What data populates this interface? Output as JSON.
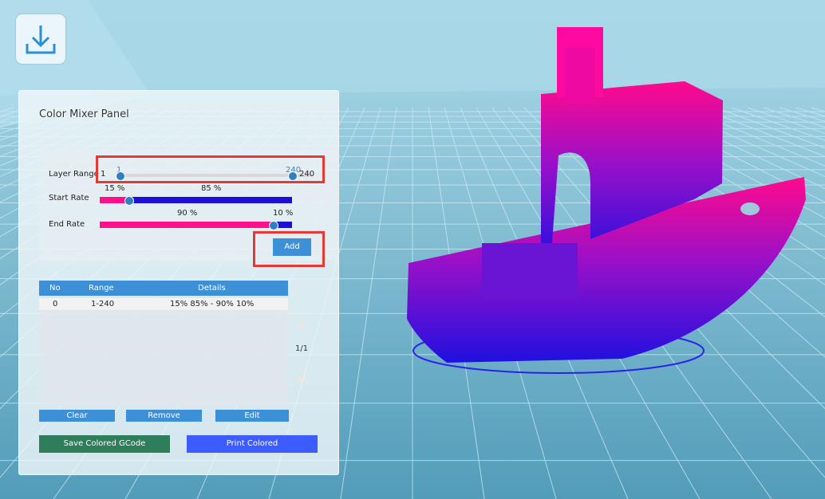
{
  "panel": {
    "title": "Color Mixer Panel",
    "layer_range": {
      "label": "Layer Range",
      "min_value": "1",
      "max_value": "240",
      "start_marker": "1",
      "end_marker": "240"
    },
    "start_rate": {
      "label": "Start Rate",
      "left_percent": "15 %",
      "right_percent": "85 %",
      "value_fraction": 0.15
    },
    "end_rate": {
      "label": "End Rate",
      "left_percent": "90 %",
      "right_percent": "10 %",
      "value_fraction": 0.9
    },
    "add_label": "Add"
  },
  "table": {
    "headers": {
      "no": "No",
      "range": "Range",
      "details": "Details"
    },
    "rows": [
      {
        "no": "0",
        "range": "1-240",
        "details": "15% 85% - 90% 10%"
      }
    ],
    "pager": "1/1"
  },
  "actions": {
    "clear_label": "Clear",
    "remove_label": "Remove",
    "edit_label": "Edit",
    "save_label": "Save Colored GCode",
    "print_label": "Print Colored"
  },
  "colors": {
    "accent_blue": "#3d8fd6",
    "save_green": "#2e7d5b",
    "print_blue": "#3d5cff",
    "gradient_start": "#ff0f8a",
    "gradient_end": "#1a10d8",
    "highlight_red": "#e53935"
  },
  "icons": {
    "download": "download-icon"
  }
}
